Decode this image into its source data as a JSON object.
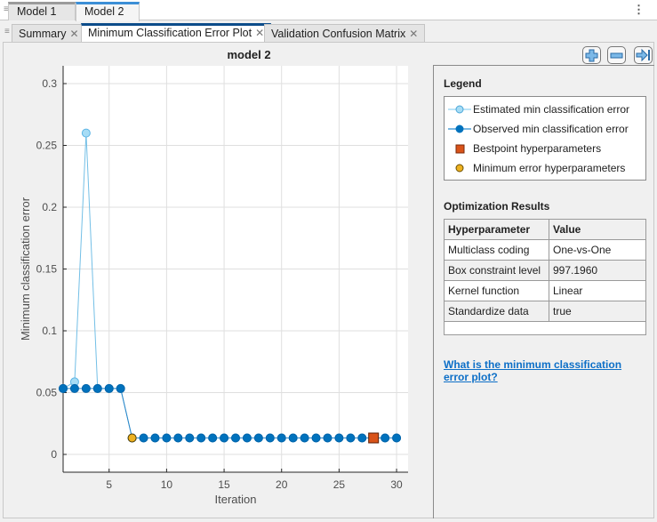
{
  "document_tabs": [
    {
      "label": "Model 1",
      "active": false
    },
    {
      "label": "Model 2",
      "active": true
    }
  ],
  "view_tabs": [
    {
      "label": "Summary",
      "active": false
    },
    {
      "label": "Minimum Classification Error Plot",
      "active": true
    },
    {
      "label": "Validation Confusion Matrix",
      "active": false
    }
  ],
  "toolbar": {
    "zoom_in": "zoom-in",
    "zoom_out": "zoom-out",
    "restore": "restore-view"
  },
  "side_panel": {
    "legend_title": "Legend",
    "legend_items": [
      {
        "label": "Estimated min classification error",
        "marker": "circle-line",
        "color": "#a6dcf5"
      },
      {
        "label": "Observed min classification error",
        "marker": "circle-line",
        "color": "#0072bd"
      },
      {
        "label": "Bestpoint hyperparameters",
        "marker": "square",
        "color": "#d95319"
      },
      {
        "label": "Minimum error hyperparameters",
        "marker": "circle",
        "color": "#edb120"
      }
    ],
    "results_title": "Optimization Results",
    "results_headers": [
      "Hyperparameter",
      "Value"
    ],
    "results_rows": [
      [
        "Multiclass coding",
        "One-vs-One"
      ],
      [
        "Box constraint level",
        "997.1960"
      ],
      [
        "Kernel function",
        "Linear"
      ],
      [
        "Standardize data",
        "true"
      ]
    ],
    "help_link": "What is the minimum classification error plot?"
  },
  "chart_data": {
    "type": "line",
    "title": "model 2",
    "xlabel": "Iteration",
    "ylabel": "Minimum classification error",
    "xlim": [
      1,
      31
    ],
    "ylim": [
      -0.0144,
      0.3144
    ],
    "xticks": [
      5,
      10,
      15,
      20,
      25,
      30
    ],
    "yticks": [
      0,
      0.05,
      0.1,
      0.15,
      0.2,
      0.25,
      0.3
    ],
    "ytick_labels": [
      "0",
      "0.05",
      "0.1",
      "0.15",
      "0.2",
      "0.25",
      "0.3"
    ],
    "grid": true,
    "x": [
      1,
      2,
      3,
      4,
      5,
      6,
      7,
      8,
      9,
      10,
      11,
      12,
      13,
      14,
      15,
      16,
      17,
      18,
      19,
      20,
      21,
      22,
      23,
      24,
      25,
      26,
      27,
      28,
      29,
      30
    ],
    "series": [
      {
        "name": "Estimated min classification error",
        "color": "#a6dcf5",
        "values": [
          0.0533,
          0.0587,
          0.26,
          0.0533,
          0.0533,
          0.0533,
          0.0133,
          0.0133,
          0.0133,
          0.0133,
          0.0133,
          0.0133,
          0.0133,
          0.0133,
          0.0133,
          0.0133,
          0.0133,
          0.0133,
          0.0133,
          0.0133,
          0.0133,
          0.0133,
          0.0133,
          0.0133,
          0.0133,
          0.0133,
          0.0133,
          0.0133,
          0.0133,
          0.0133
        ]
      },
      {
        "name": "Observed min classification error",
        "color": "#0072bd",
        "values": [
          0.0533,
          0.0533,
          0.0533,
          0.0533,
          0.0533,
          0.0533,
          0.0133,
          0.0133,
          0.0133,
          0.0133,
          0.0133,
          0.0133,
          0.0133,
          0.0133,
          0.0133,
          0.0133,
          0.0133,
          0.0133,
          0.0133,
          0.0133,
          0.0133,
          0.0133,
          0.0133,
          0.0133,
          0.0133,
          0.0133,
          0.0133,
          0.0133,
          0.0133,
          0.0133
        ]
      }
    ],
    "markers": [
      {
        "name": "Minimum error hyperparameters",
        "x": 7,
        "y": 0.0133,
        "shape": "circle",
        "color": "#edb120"
      },
      {
        "name": "Bestpoint hyperparameters",
        "x": 28,
        "y": 0.0133,
        "shape": "square",
        "color": "#d95319"
      }
    ],
    "legend": "side-panel"
  }
}
